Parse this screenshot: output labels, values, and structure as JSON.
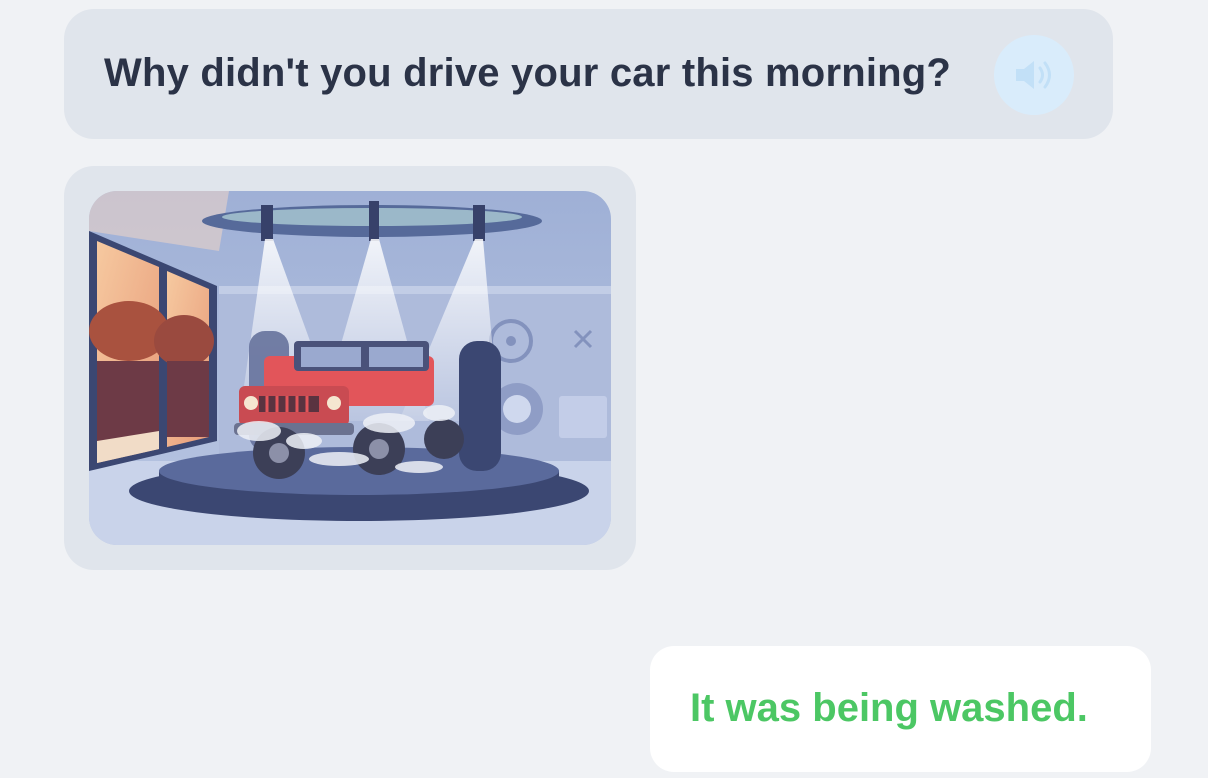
{
  "question": {
    "text": "Why didn't you drive your car this morning?",
    "audio_icon": "speaker-icon"
  },
  "image": {
    "icon": "car-wash-illustration"
  },
  "answer": {
    "text": "It was being washed.",
    "color": "#4cc764"
  },
  "colors": {
    "background": "#f0f2f5",
    "bubble": "#e0e5ec",
    "question_text": "#2b3347",
    "audio_button": "#d9ecfb"
  }
}
